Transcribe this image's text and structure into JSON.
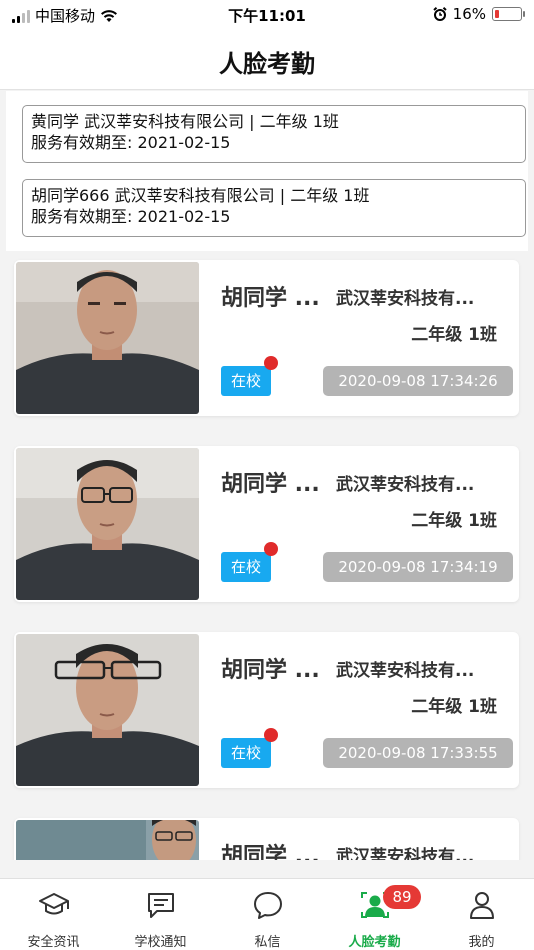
{
  "status_bar": {
    "carrier": "中国移动",
    "time": "下午11:01",
    "battery": "16%",
    "battery_color": "#e53935"
  },
  "header": {
    "title": "人脸考勤"
  },
  "students": [
    {
      "line1": "黄同学  武汉莘安科技有限公司 | 二年级 1班",
      "line2": "服务有效期至: 2021-02-15"
    },
    {
      "line1": "胡同学666  武汉莘安科技有限公司 | 二年级 1班",
      "line2": "服务有效期至: 2021-02-15"
    }
  ],
  "records": [
    {
      "name": "胡同学 ...",
      "company": "武汉莘安科技有...",
      "grade": "二年级 1班",
      "status": "在校",
      "time": "2020-09-08 17:34:26",
      "photo_icon": "face-photo"
    },
    {
      "name": "胡同学 ...",
      "company": "武汉莘安科技有...",
      "grade": "二年级 1班",
      "status": "在校",
      "time": "2020-09-08 17:34:19",
      "photo_icon": "face-photo"
    },
    {
      "name": "胡同学 ...",
      "company": "武汉莘安科技有...",
      "grade": "二年级 1班",
      "status": "在校",
      "time": "2020-09-08 17:33:55",
      "photo_icon": "face-photo"
    },
    {
      "name": "胡同学 ...",
      "company": "武汉莘安科技有...",
      "grade": "",
      "status": "",
      "time": "",
      "photo_icon": "face-photo"
    }
  ],
  "colors": {
    "accent_green": "#1aab4a",
    "status_blue": "#18a9f0",
    "badge_red": "#e53935"
  },
  "tabs": [
    {
      "label": "安全资讯",
      "icon": "graduation-cap-icon",
      "active": false
    },
    {
      "label": "学校通知",
      "icon": "message-square-icon",
      "active": false
    },
    {
      "label": "私信",
      "icon": "chat-bubble-icon",
      "active": false
    },
    {
      "label": "人脸考勤",
      "icon": "face-user-icon",
      "active": true
    },
    {
      "label": "我的",
      "icon": "user-icon",
      "active": false
    }
  ],
  "attendance_badge": "89"
}
